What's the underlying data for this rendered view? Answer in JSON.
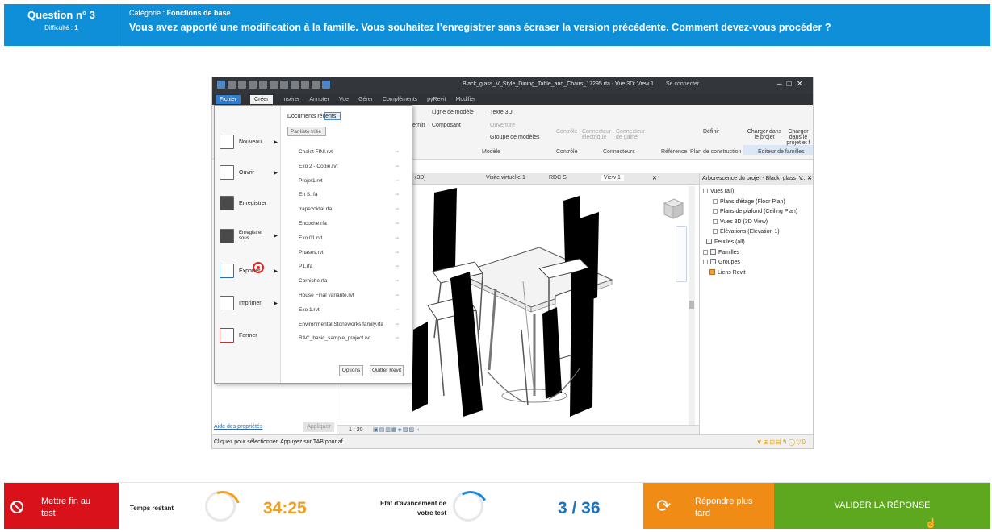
{
  "header": {
    "question_label": "Question n° 3",
    "difficulty_label": "Difficulté :",
    "difficulty_value": "1",
    "category_label": "Catégorie :",
    "category_value": "Fonctions de base",
    "question_text": "Vous avez apporté une modification à la famille. Vous souhaitez l'enregistrer sans écraser la version précédente. Comment devez-vous procéder ?"
  },
  "revit": {
    "window_title": "Black_glass_V_Style_Dining_Table_and_Chairs_17295.rfa - Vue 3D: View 1",
    "sign_in": "Se connecter",
    "menu": [
      "Fichier",
      "Créer",
      "Insérer",
      "Annoter",
      "Vue",
      "Gérer",
      "Compléments",
      "pyRevit",
      "Modifier"
    ],
    "ribbon": {
      "items": [
        "Ligne de modèle",
        "Texte 3D",
        "Composant",
        "Ouverture",
        "Groupe de modèles",
        "Contrôle",
        "Connecteur électrique",
        "Connecteur de gaine",
        "Définir",
        "Charger dans le projet",
        "Charger dans le projet et f"
      ],
      "fragment": "ernin",
      "panels": [
        "Modèle",
        "Contrôle",
        "Connecteurs",
        "Référence",
        "Plan de construction",
        "Éditeur de familles"
      ]
    },
    "file_menu": {
      "commands": [
        "Nouveau",
        "Ouvrir",
        "Enregistrer",
        "Enregistrer sous",
        "Exporter",
        "Imprimer",
        "Fermer"
      ],
      "recent_label": "Documents récents",
      "sort_label": "Par liste triée",
      "recent_files": [
        "Chalet FINI.rvt",
        "Exo 2 - Copie.rvt",
        "Projet1.rvt",
        "En S.rfa",
        "trapezoidal.rfa",
        "Encoche.rfa",
        "Exo 01.rvt",
        "Phases.rvt",
        "P1.rfa",
        "Corniche.rfa",
        "House Final variante.rvt",
        "Exo 1.rvt",
        "Environmental Stoneworks family.rfa",
        "RAC_basic_sample_project.rvt"
      ],
      "options_button": "Options",
      "quit_button": "Quitter Revit"
    },
    "view_tabs": [
      "(3D)",
      "Visite virtuelle 1",
      "RDC S",
      "View 1"
    ],
    "properties": {
      "help_link": "Aide des propriétés",
      "apply_button": "Appliquer"
    },
    "view_scale": "1 : 20",
    "browser": {
      "title": "Arborescence du projet - Black_glass_V...",
      "items": [
        "Vues (all)",
        "Plans d'étage (Floor Plan)",
        "Plans de plafond (Ceiling Plan)",
        "Vues 3D (3D View)",
        "Élévations (Elevation 1)",
        "Feuilles (all)",
        "Familles",
        "Groupes",
        "Liens Revit"
      ]
    },
    "status_text": "Cliquez pour sélectionner. Appuyez sur TAB pour af",
    "status_filter_count": "0"
  },
  "footer": {
    "end_test_label": "Mettre fin au test",
    "time_label": "Temps restant",
    "time_value": "34:25",
    "time_progress_fraction": 0.08,
    "progress_label": "Etat d'avancement de votre test",
    "progress_value": "3 / 36",
    "answer_later_label": "Répondre plus tard",
    "validate_label": "VALIDER LA RÉPONSE"
  },
  "colors": {
    "header_bg": "#0f8fd8",
    "end_button": "#d8111a",
    "time_accent": "#f0a01e",
    "progress_accent": "#1a73c2",
    "later_button": "#f08c16",
    "validate_button": "#5da81f"
  }
}
